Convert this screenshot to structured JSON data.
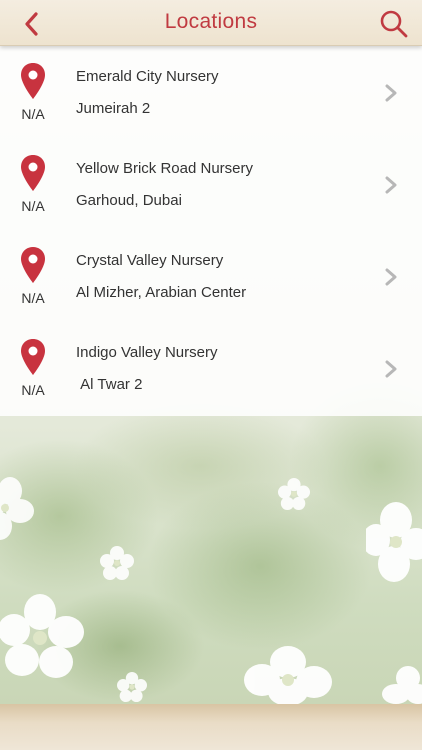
{
  "header": {
    "title": "Locations",
    "back_icon": "chevron-left-icon",
    "search_icon": "search-icon"
  },
  "colors": {
    "accent": "#c03a41",
    "header_bg": "#f1e8d6",
    "text": "#333333"
  },
  "locations": [
    {
      "name": "Emerald City Nursery",
      "area": "Jumeirah 2",
      "distance": "N/A"
    },
    {
      "name": "Yellow Brick Road Nursery",
      "area": "Garhoud, Dubai",
      "distance": "N/A"
    },
    {
      "name": "Crystal Valley Nursery",
      "area": "Al Mizher, Arabian Center",
      "distance": "N/A"
    },
    {
      "name": "Indigo Valley Nursery",
      "area": " Al Twar 2",
      "distance": "N/A"
    }
  ]
}
